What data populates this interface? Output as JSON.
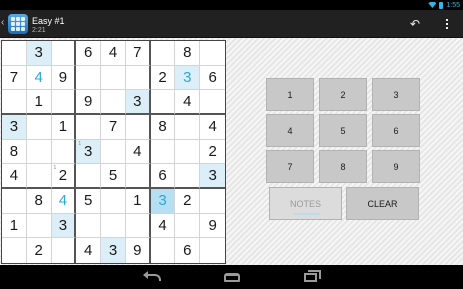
{
  "status_bar": {
    "time": "1:55",
    "wifi_icon": "wifi-icon",
    "battery_icon": "battery-icon"
  },
  "action_bar": {
    "title": "Easy #1",
    "subtitle": "2:21",
    "app_icon": "sudoku-app-icon",
    "undo_icon": "undo-icon",
    "overflow_icon": "overflow-menu-icon"
  },
  "board": {
    "rows": [
      [
        "",
        "3",
        "",
        "6",
        "4",
        "7",
        "",
        "8",
        ""
      ],
      [
        "7",
        "4",
        "9",
        "",
        "",
        "",
        "2",
        "3",
        "6"
      ],
      [
        "",
        "1",
        "",
        "9",
        "",
        "3",
        "",
        "4",
        ""
      ],
      [
        "3",
        "",
        "1",
        "",
        "7",
        "",
        "8",
        "",
        "4"
      ],
      [
        "8",
        "",
        "",
        "3",
        "",
        "4",
        "",
        "",
        "2"
      ],
      [
        "4",
        "",
        "2",
        "",
        "5",
        "",
        "6",
        "",
        "3"
      ],
      [
        "",
        "8",
        "4",
        "5",
        "",
        "1",
        "3",
        "2",
        ""
      ],
      [
        "1",
        "",
        "3",
        "",
        "",
        "",
        "4",
        "",
        "9"
      ],
      [
        "",
        "2",
        "",
        "4",
        "3",
        "9",
        "",
        "6",
        ""
      ]
    ],
    "notes": [
      {
        "row": 4,
        "col": 3,
        "text": "1"
      },
      {
        "row": 5,
        "col": 2,
        "text": "1"
      }
    ],
    "user_entered": [
      [
        1,
        1
      ],
      [
        1,
        7
      ],
      [
        6,
        2
      ],
      [
        6,
        6
      ]
    ],
    "highlighted": [
      [
        0,
        1
      ],
      [
        1,
        7
      ],
      [
        2,
        5
      ],
      [
        3,
        0
      ],
      [
        4,
        3
      ],
      [
        5,
        8
      ],
      [
        7,
        2
      ],
      [
        8,
        4
      ]
    ],
    "selected": [
      [
        6,
        6
      ]
    ],
    "colors": {
      "highlight": "#dceef8",
      "selected": "#b7dff3",
      "user_digit": "#33a5d6"
    }
  },
  "keypad": {
    "digits": [
      "1",
      "2",
      "3",
      "4",
      "5",
      "6",
      "7",
      "8",
      "9"
    ],
    "notes_label": "NOTES",
    "clear_label": "CLEAR"
  },
  "nav_bar": {
    "back_icon": "back-icon",
    "home_icon": "home-icon",
    "recents_icon": "recent-apps-icon"
  }
}
